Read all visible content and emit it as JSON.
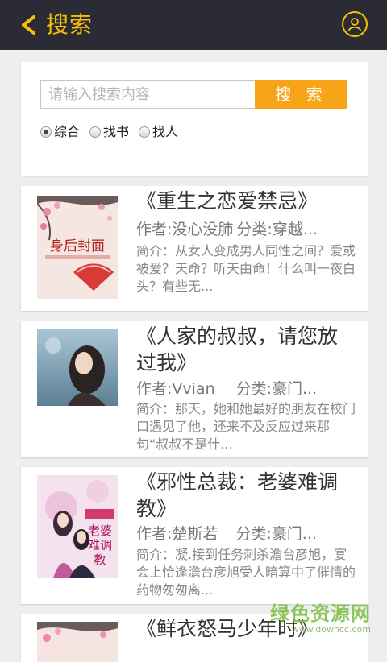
{
  "header": {
    "title": "搜索",
    "accent": "#f5c200",
    "background": "#2b2b35",
    "back_icon": "chevron-left-icon",
    "user_icon": "user-icon"
  },
  "search": {
    "placeholder": "请输入搜索内容",
    "value": "",
    "button_label": "搜 索",
    "button_color": "#f7a418",
    "options": [
      {
        "label": "综合",
        "checked": true
      },
      {
        "label": "找书",
        "checked": false
      },
      {
        "label": "找人",
        "checked": false
      }
    ]
  },
  "books": [
    {
      "title": "《重生之恋爱禁忌》",
      "author": "作者:没心没肺",
      "category": "分类:穿越...",
      "description": "简介：从女人变成男人同性之间？爱或被爱？天命？听天由命！什么叫一夜白头？有些无...",
      "cover_text": "身后封面"
    },
    {
      "title": "《人家的叔叔，请您放过我》",
      "author": "作者:Vvian",
      "category": "分类:豪门...",
      "description": "简介：那天，她和她最好的朋友在校门口遇见了他，还来不及反应过来那句“叔叔不是什...",
      "cover_text": ""
    },
    {
      "title": "《邪性总裁：老婆难调教》",
      "author": "作者:楚斯若",
      "category": "分类:豪门...",
      "description": "简介：凝.接到任务刺杀澹台彦旭，宴会上恰逢澹台彦旭受人暗算中了催情的药物匆匆离...",
      "cover_text": "老婆难调教"
    },
    {
      "title": "《鲜衣怒马少年时》",
      "author": "",
      "category": "",
      "description": "",
      "cover_text": ""
    }
  ],
  "watermark": {
    "big": "绿色资源网",
    "small": "www.downcc.com"
  }
}
